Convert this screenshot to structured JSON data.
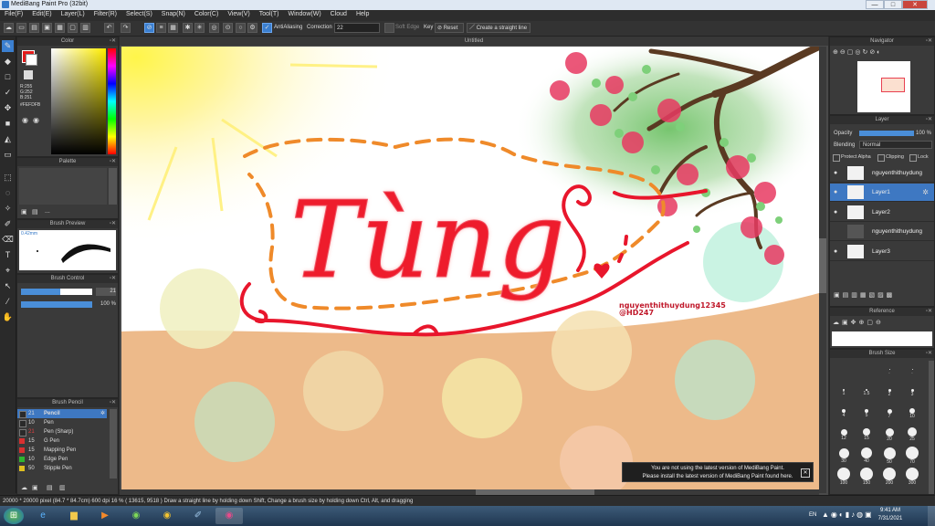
{
  "window": {
    "title": "MediBang Paint Pro (32bit)",
    "minimize": "—",
    "maximize": "□",
    "close": "✕"
  },
  "menu": [
    "File(F)",
    "Edit(E)",
    "Layer(L)",
    "Filter(R)",
    "Select(S)",
    "Snap(N)",
    "Color(C)",
    "View(V)",
    "Tool(T)",
    "Window(W)",
    "Cloud",
    "Help"
  ],
  "toolbar": {
    "antialias_label": "AntiAliasing",
    "correction_label": "Correction",
    "correction_value": "22",
    "soft_edge_label": "Soft Edge",
    "key_label": "Key",
    "reset_label": "Reset",
    "straight_line_label": "Create a straight line"
  },
  "canvas": {
    "tab_title": "Untitled",
    "art_text": "Tùng",
    "signature_line1": "nguyenthithuydung12345",
    "signature_line2": "@HD247"
  },
  "color_panel": {
    "title": "Color",
    "r": "R:255",
    "g": "G:252",
    "b": "B:251",
    "hex": "#FEFDFB"
  },
  "palette_panel": {
    "title": "Palette",
    "ellipsis": "..."
  },
  "brush_preview": {
    "title": "Brush Preview",
    "size": "0.42mm"
  },
  "brush_control": {
    "title": "Brush Control",
    "size_value": "21",
    "opacity_value": "100 %",
    "size_fraction": 0.55,
    "opacity_fraction": 1.0
  },
  "brush_list": {
    "title": "Brush Pencil",
    "items": [
      {
        "size": "21",
        "name": "Pencil",
        "color": "#3e78c2"
      },
      {
        "size": "10",
        "name": "Pen",
        "color": "#2a2a2a"
      },
      {
        "size": "21",
        "name": "Pen (Sharp)",
        "color": "#2a2a2a"
      },
      {
        "size": "15",
        "name": "G Pen",
        "color": "#d83030"
      },
      {
        "size": "15",
        "name": "Mapping Pen",
        "color": "#d83030"
      },
      {
        "size": "10",
        "name": "Edge Pen",
        "color": "#2fb52f"
      },
      {
        "size": "50",
        "name": "Stipple Pen",
        "color": "#e0c020"
      }
    ]
  },
  "navigator": {
    "title": "Navigator"
  },
  "layer_panel": {
    "title": "Layer",
    "opacity_label": "Opacity",
    "opacity_value": "100 %",
    "blending_label": "Blending",
    "blending_value": "Normal",
    "protect_alpha": "Protect Alpha",
    "clipping": "Clipping",
    "lock": "Lock",
    "layers": [
      {
        "name": "nguyenthithuydung",
        "selected": false
      },
      {
        "name": "Layer1",
        "selected": true
      },
      {
        "name": "Layer2",
        "selected": false
      },
      {
        "name": "nguyenthithuydung",
        "selected": false
      },
      {
        "name": "Layer3",
        "selected": false
      }
    ]
  },
  "reference_panel": {
    "title": "Reference"
  },
  "brush_size_panel": {
    "title": "Brush Size",
    "sizes": [
      "",
      "",
      ".",
      ".",
      "1",
      "1.5",
      "2",
      "3",
      "4",
      "5",
      "7",
      "10",
      "12",
      "15",
      "20",
      "25",
      "30",
      "40",
      "50",
      "70",
      "100",
      "150",
      "200",
      "300"
    ]
  },
  "notice": {
    "line1": "You are not using the latest version of MediBang Paint.",
    "line2": "Please install the latest version of MediBang Paint found here."
  },
  "status": {
    "text": "20000 * 20000 pixel  (84.7 * 84.7cm)  600 dpi  16 %  ( 13615, 9518 )  Draw a straight line by holding down Shift, Change a brush size by holding down Ctrl, Alt, and dragging"
  },
  "taskbar": {
    "lang": "EN",
    "time": "9:41 AM",
    "date": "7/31/2021"
  },
  "colors": {
    "accent": "#3e78c2",
    "red_ink": "#e8162c",
    "orange_dash": "#ef8a2a",
    "sand": "#edba8a"
  }
}
